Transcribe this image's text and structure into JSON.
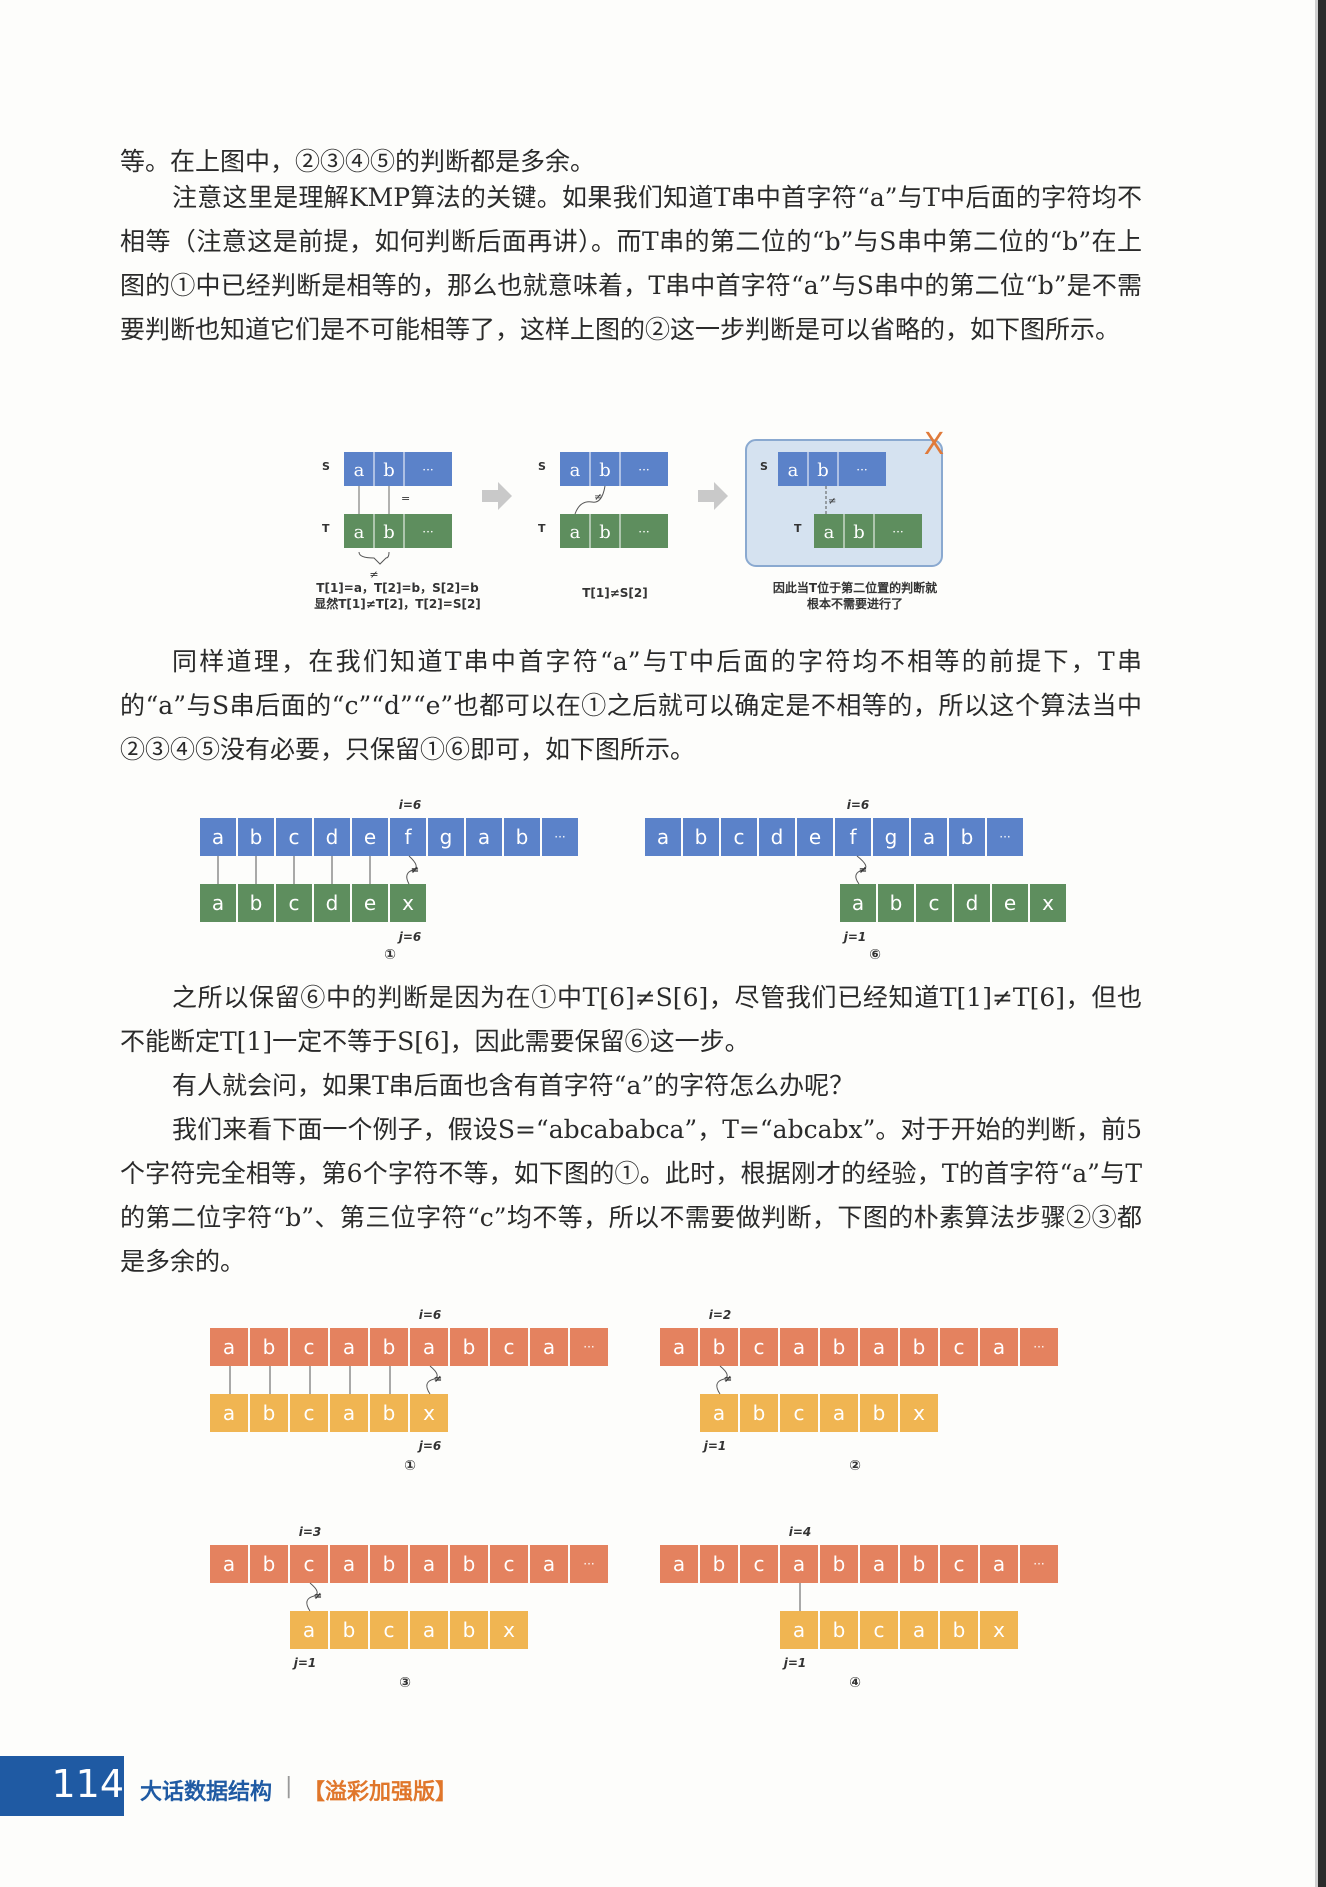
{
  "paragraphs": [
    "等。在上图中，②③④⑤的判断都是多余。",
    "注意这里是理解KMP算法的关键。如果我们知道T串中首字符“a”与T中后面的字符均不相等（注意这是前提，如何判断后面再讲）。而T串的第二位的“b”与S串中第二位的“b”在上图的①中已经判断是相等的，那么也就意味着，T串中首字符“a”与S串中的第二位“b”是不需要判断也知道它们是不可能相等了，这样上图的②这一步判断是可以省略的，如下图所示。",
    "同样道理，在我们知道T串中首字符“a”与T中后面的字符均不相等的前提下，T串的“a”与S串后面的“c”“d”“e”也都可以在①之后就可以确定是不相等的，所以这个算法当中②③④⑤没有必要，只保留①⑥即可，如下图所示。",
    "之所以保留⑥中的判断是因为在①中T[6]≠S[6]，尽管我们已经知道T[1]≠T[6]，但也不能断定T[1]一定不等于S[6]，因此需要保留⑥这一步。",
    "有人就会问，如果T串后面也含有首字符“a”的字符怎么办呢？",
    "我们来看下面一个例子，假设S=“abcababca”，T=“abcabx”。对于开始的判断，前5个字符完全相等，第6个字符不等，如下图的①。此时，根据刚才的经验，T的首字符“a”与T的第二位字符“b”、第三位字符“c”均不等，所以不需要做判断，下图的朴素算法步骤②③都是多余的。"
  ],
  "fig1": {
    "s_label": "S",
    "t_label": "T",
    "cells": [
      "a",
      "b",
      "···"
    ],
    "eq": "=",
    "neq": "≠",
    "cap1": "T[1]=a，T[2]=b，S[2]=b\n显然T[1]≠T[2]，T[2]=S[2]",
    "cap2": "T[1]≠S[2]",
    "cap3": "因此当T位于第二位置的判断就\n根本不需要进行了",
    "x_mark": "X"
  },
  "fig2": {
    "s_cells": [
      "a",
      "b",
      "c",
      "d",
      "e",
      "f",
      "g",
      "a",
      "b",
      "···"
    ],
    "t_cells": [
      "a",
      "b",
      "c",
      "d",
      "e",
      "x"
    ],
    "i_label": "i=6",
    "j1": "j=6",
    "j2": "j=1",
    "n1": "①",
    "n2": "⑥"
  },
  "fig3": {
    "s_cells": [
      "a",
      "b",
      "c",
      "a",
      "b",
      "a",
      "b",
      "c",
      "a",
      "···"
    ],
    "t_cells": [
      "a",
      "b",
      "c",
      "a",
      "b",
      "x"
    ],
    "panels": [
      {
        "i": "i=6",
        "j": "j=6",
        "n": "①"
      },
      {
        "i": "i=2",
        "j": "j=1",
        "n": "②"
      },
      {
        "i": "i=3",
        "j": "j=1",
        "n": "③"
      },
      {
        "i": "i=4",
        "j": "j=1",
        "n": "④"
      }
    ]
  },
  "footer": {
    "page": "114",
    "title": "大话数据结构",
    "sep": "|",
    "edition": "【溢彩加强版】"
  },
  "colors": {
    "blue": "#5b82c9",
    "green": "#5e8e5e",
    "orange_s": "#e4825f",
    "orange_t": "#f0b552",
    "footer": "#1f5aa3"
  }
}
